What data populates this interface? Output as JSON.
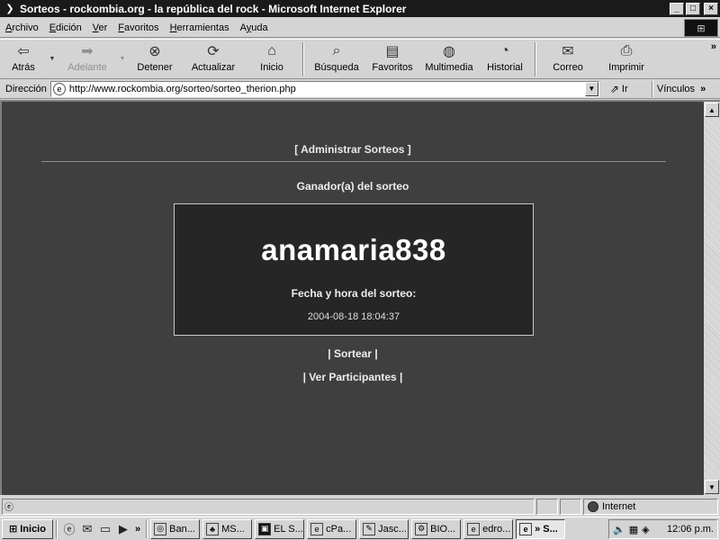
{
  "window": {
    "title": "Sorteos - rockombia.org - la república del rock - Microsoft Internet Explorer",
    "controls": {
      "minimize": "_",
      "maximize": "□",
      "close": "×"
    }
  },
  "menu": [
    {
      "label": "Archivo",
      "accel": "A",
      "rest": "rchivo"
    },
    {
      "label": "Edición",
      "accel": "E",
      "rest": "dición"
    },
    {
      "label": "Ver",
      "accel": "V",
      "rest": "er"
    },
    {
      "label": "Favoritos",
      "accel": "F",
      "rest": "avoritos"
    },
    {
      "label": "Herramientas",
      "accel": "H",
      "rest": "erramientas"
    },
    {
      "label": "Ayuda",
      "accel": "y",
      "pre": "A",
      "rest": "uda"
    }
  ],
  "toolbar": {
    "back": "Atrás",
    "forward": "Adelante",
    "stop": "Detener",
    "refresh": "Actualizar",
    "home": "Inicio",
    "search": "Búsqueda",
    "favorites": "Favoritos",
    "media": "Multimedia",
    "history": "Historial",
    "mail": "Correo",
    "print": "Imprimir",
    "more": "»"
  },
  "address": {
    "label": "Dirección",
    "url": "http://www.rockombia.org/sorteo/sorteo_therion.php",
    "go": "Ir",
    "links": "Vínculos",
    "links_more": "»"
  },
  "page": {
    "admin_link": "[ Administrar Sorteos ]",
    "winner_heading": "Ganador(a) del sorteo",
    "winner_name": "anamaria838",
    "date_label": "Fecha y hora del sorteo:",
    "date_value": "2004-08-18 18:04:37",
    "draw_link": "| Sortear |",
    "participants_link": "| Ver Participantes |"
  },
  "status": {
    "zone": "Internet"
  },
  "taskbar": {
    "start": "Inicio",
    "quick_more": "»",
    "tasks": [
      "Ban...",
      "MS...",
      "EL S...",
      "cPa...",
      "Jasc...",
      "BIO...",
      "edro...",
      "» S..."
    ],
    "clock": "12:06 p.m."
  },
  "colors": {
    "page_background": "#3f3f3f",
    "winner_box_background": "#262626",
    "title_bar": "#1a1a1a"
  }
}
